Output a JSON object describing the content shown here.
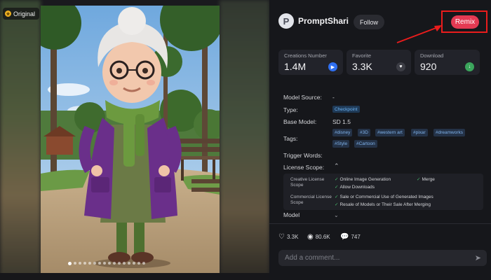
{
  "image_panel": {
    "badge_label": "Original",
    "carousel_count": 16,
    "carousel_active": 0
  },
  "author": {
    "avatar_initial": "P",
    "name": "PromptShari...",
    "follow_label": "Follow"
  },
  "remix_label": "Remix",
  "stats": [
    {
      "label": "Creations Number",
      "value": "1.4M",
      "icon": "play-icon",
      "color": "#2f6ff0"
    },
    {
      "label": "Favorite",
      "value": "3.3K",
      "icon": "heart-icon",
      "color": "#3c3d45"
    },
    {
      "label": "Download",
      "value": "920",
      "icon": "download-icon",
      "color": "#3ba55c"
    }
  ],
  "model_info": {
    "source_label": "Model Source:",
    "source_value": "-",
    "type_label": "Type:",
    "type_value": "Checkpoint",
    "base_label": "Base Model:",
    "base_value": "SD 1.5",
    "tags_label": "Tags:",
    "tags": [
      "#disney",
      "#3D",
      "#western art",
      "#pixar",
      "#dreamworks",
      "#Style",
      "#Cartoon"
    ],
    "trigger_label": "Trigger Words:",
    "license_label": "License Scope:"
  },
  "license": {
    "creative_label": "Creative License Scope",
    "creative_items": [
      "Online Image Generation",
      "Merge",
      "Allow Downloads"
    ],
    "commercial_label": "Commercial License Scope",
    "commercial_items": [
      "Sale or Commercial Use of Generated Images",
      "Resale of Models or Their Sale After Merging"
    ]
  },
  "model_cut_label": "Model",
  "reactions": {
    "likes": "3.3K",
    "views": "80.6K",
    "comments": "747"
  },
  "comment_placeholder": "Add a comment...",
  "colors": {
    "remix": "#e43a53",
    "highlight_box": "#ea1c1c",
    "tag_text": "#7fb2ea"
  }
}
